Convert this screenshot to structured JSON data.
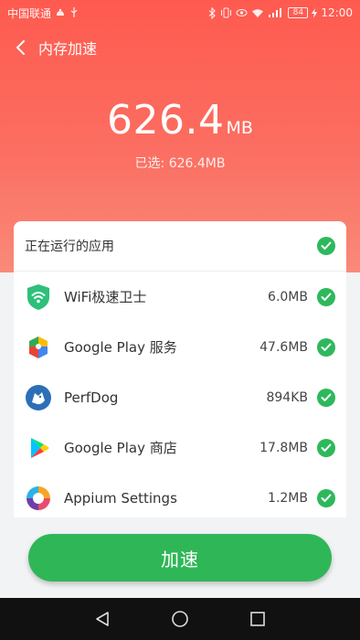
{
  "status_bar": {
    "carrier": "中国联通",
    "battery": "84",
    "time": "12:00"
  },
  "header": {
    "title": "内存加速"
  },
  "summary": {
    "size_value": "626.4",
    "size_unit": "MB",
    "selected_text": "已选: 626.4MB"
  },
  "list": {
    "header_label": "正在运行的应用",
    "apps": [
      {
        "name": "WiFi极速卫士",
        "size": "6.0MB",
        "icon": "wifi-guard-icon"
      },
      {
        "name": "Google Play 服务",
        "size": "47.6MB",
        "icon": "google-play-services-icon"
      },
      {
        "name": "PerfDog",
        "size": "894KB",
        "icon": "perfdog-icon"
      },
      {
        "name": "Google Play 商店",
        "size": "17.8MB",
        "icon": "google-play-store-icon"
      },
      {
        "name": "Appium Settings",
        "size": "1.2MB",
        "icon": "appium-settings-icon"
      }
    ]
  },
  "action": {
    "accelerate_label": "加速"
  },
  "colors": {
    "hero_red": "#ff5a4f",
    "accent_green": "#2eb85c"
  }
}
